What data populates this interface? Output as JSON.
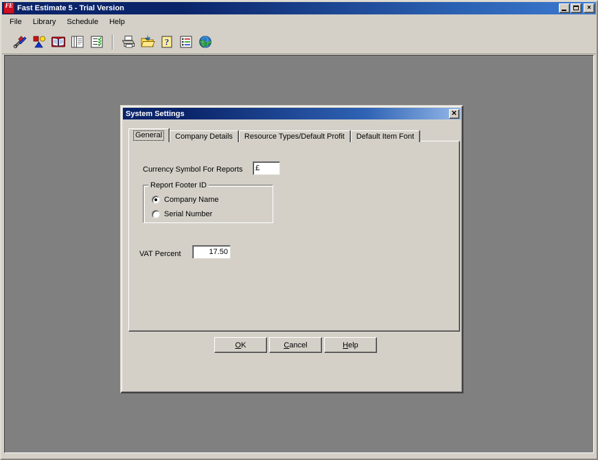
{
  "app": {
    "title": "Fast Estimate 5 - Trial Version",
    "icon": "app-logo-icon",
    "icon_text": "FE",
    "caption_buttons": {
      "minimize": "minimize-button",
      "maximize": "maximize-button",
      "close": "close-button",
      "close_glyph": "×"
    }
  },
  "menu": {
    "items": [
      {
        "label": "File"
      },
      {
        "label": "Library"
      },
      {
        "label": "Schedule"
      },
      {
        "label": "Help"
      }
    ]
  },
  "toolbar": {
    "buttons": [
      {
        "name": "estimate-tools-icon",
        "tooltip": "Estimate Tools"
      },
      {
        "name": "resources-icon",
        "tooltip": "Resources"
      },
      {
        "name": "library-book-icon",
        "tooltip": "Library"
      },
      {
        "name": "copy-pages-icon",
        "tooltip": "Copy"
      },
      {
        "name": "checklist-icon",
        "tooltip": "Check List"
      },
      {
        "name": "print-icon",
        "tooltip": "Print"
      },
      {
        "name": "open-folder-icon",
        "tooltip": "Open"
      },
      {
        "name": "help-question-icon",
        "tooltip": "Help"
      },
      {
        "name": "report-list-icon",
        "tooltip": "Reports"
      },
      {
        "name": "globe-icon",
        "tooltip": "Web"
      }
    ]
  },
  "dialog": {
    "title": "System Settings",
    "close_glyph": "✕",
    "tabs": [
      {
        "label": "General",
        "active": true
      },
      {
        "label": "Company Details",
        "active": false
      },
      {
        "label": "Resource Types/Default Profit",
        "active": false
      },
      {
        "label": "Default Item Font",
        "active": false
      }
    ],
    "general": {
      "currency_label": "Currency Symbol For Reports",
      "currency_value": "£",
      "currency_placeholder": "",
      "footer_group_title": "Report Footer ID",
      "footer_options": [
        {
          "label": "Company Name",
          "selected": true
        },
        {
          "label": "Serial Number",
          "selected": false
        }
      ],
      "vat_label": "VAT Percent",
      "vat_value": "17.50",
      "vat_placeholder": ""
    },
    "buttons": {
      "ok": {
        "pre": "",
        "accel": "O",
        "post": "K"
      },
      "cancel": {
        "pre": "",
        "accel": "C",
        "post": "ancel"
      },
      "help": {
        "pre": "",
        "accel": "H",
        "post": "elp"
      }
    }
  },
  "colors": {
    "face": "#d4d0c8",
    "desktop": "#808080",
    "title_active_start": "#0a246a",
    "title_active_end": "#3b7ad0",
    "accent_red": "#cf1020"
  }
}
